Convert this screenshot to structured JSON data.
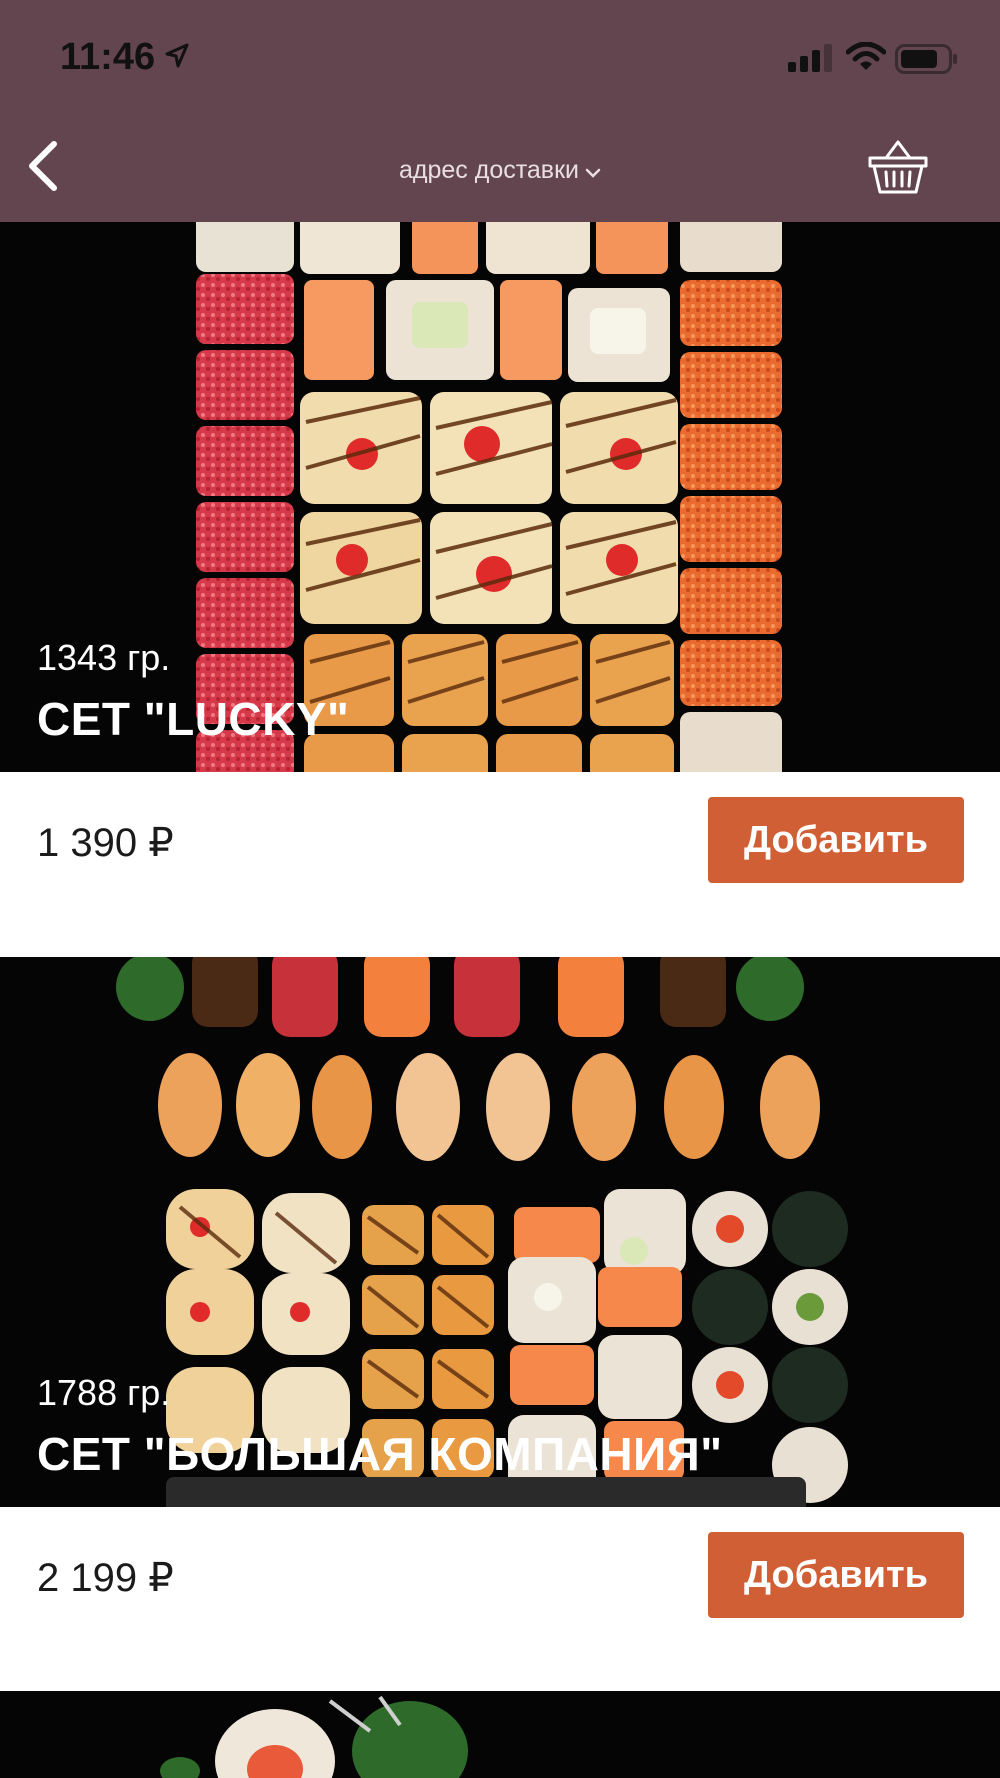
{
  "status_bar": {
    "time": "11:46"
  },
  "nav": {
    "address_label": "адрес доставки"
  },
  "products": [
    {
      "weight": "1343 гр.",
      "title": "СЕТ \"LUCKY\"",
      "price": "1 390 ₽",
      "button": "Добавить"
    },
    {
      "weight": "1788 гр.",
      "title": "СЕТ \"БОЛЬШАЯ КОМПАНИЯ\"",
      "price": "2 199 ₽",
      "button": "Добавить"
    }
  ],
  "colors": {
    "header": "#634550",
    "accent": "#d05f35",
    "image_bg": "#050505"
  },
  "icons": [
    "location-arrow-icon",
    "signal-icon",
    "wifi-icon",
    "battery-icon",
    "back-arrow-icon",
    "chevron-down-icon",
    "basket-icon"
  ]
}
